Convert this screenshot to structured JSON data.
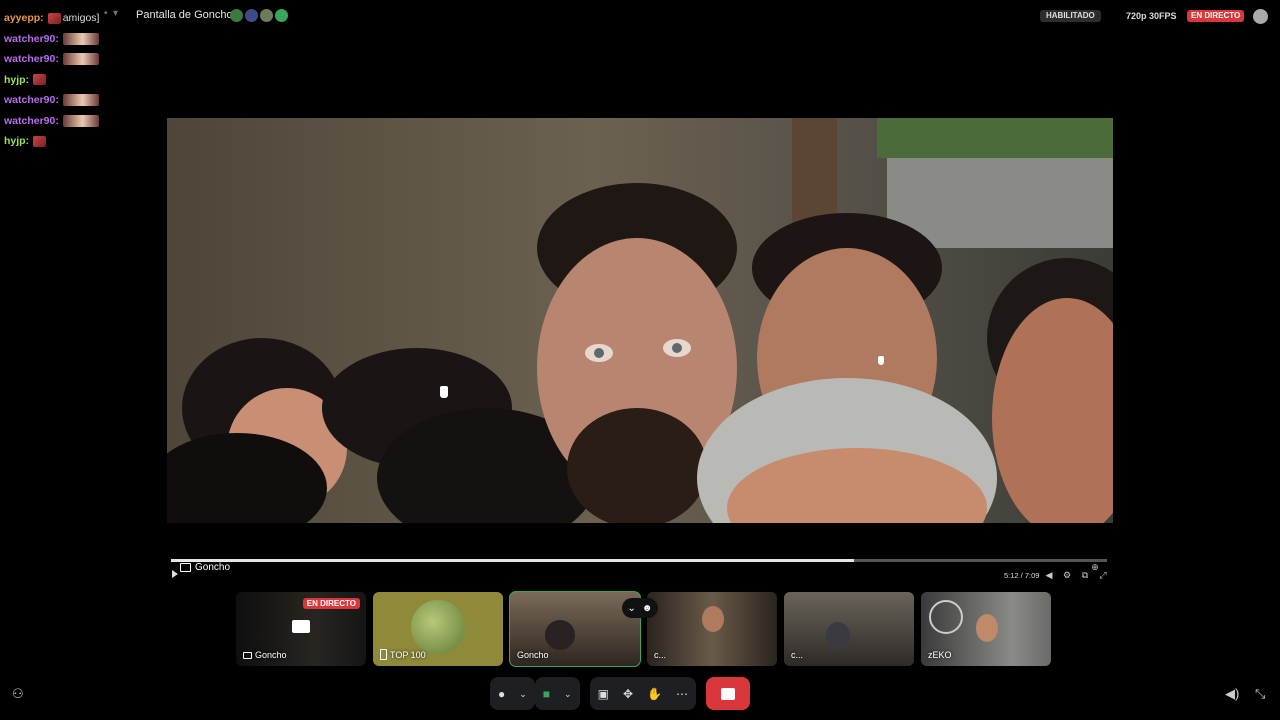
{
  "topbar": {
    "channel_label": "amigos]",
    "title": "Pantalla de Goncho",
    "habilitado": "HABILITADO",
    "quality": "720p 30FPS",
    "live": "EN DIRECTO"
  },
  "chat": [
    {
      "user": "ayyepp:",
      "color": "#e89a4b"
    },
    {
      "user": "watcher90:",
      "color": "#b86cf0"
    },
    {
      "user": "watcher90:",
      "color": "#b86cf0"
    },
    {
      "user": "hyjp:",
      "color": "#9ee25e"
    },
    {
      "user": "watcher90:",
      "color": "#b86cf0"
    },
    {
      "user": "watcher90:",
      "color": "#b86cf0"
    },
    {
      "user": "hyjp:",
      "color": "#9ee25e"
    }
  ],
  "stream": {
    "name": "Goncho",
    "time": "5:12 / 7:09",
    "progress": 0.73
  },
  "tiles": [
    {
      "label": "Goncho",
      "live": "EN DIRECTO"
    },
    {
      "label": "TOP 100"
    },
    {
      "label": "Goncho"
    },
    {
      "label": "c..."
    },
    {
      "label": "c..."
    },
    {
      "label": "zEKO"
    }
  ]
}
